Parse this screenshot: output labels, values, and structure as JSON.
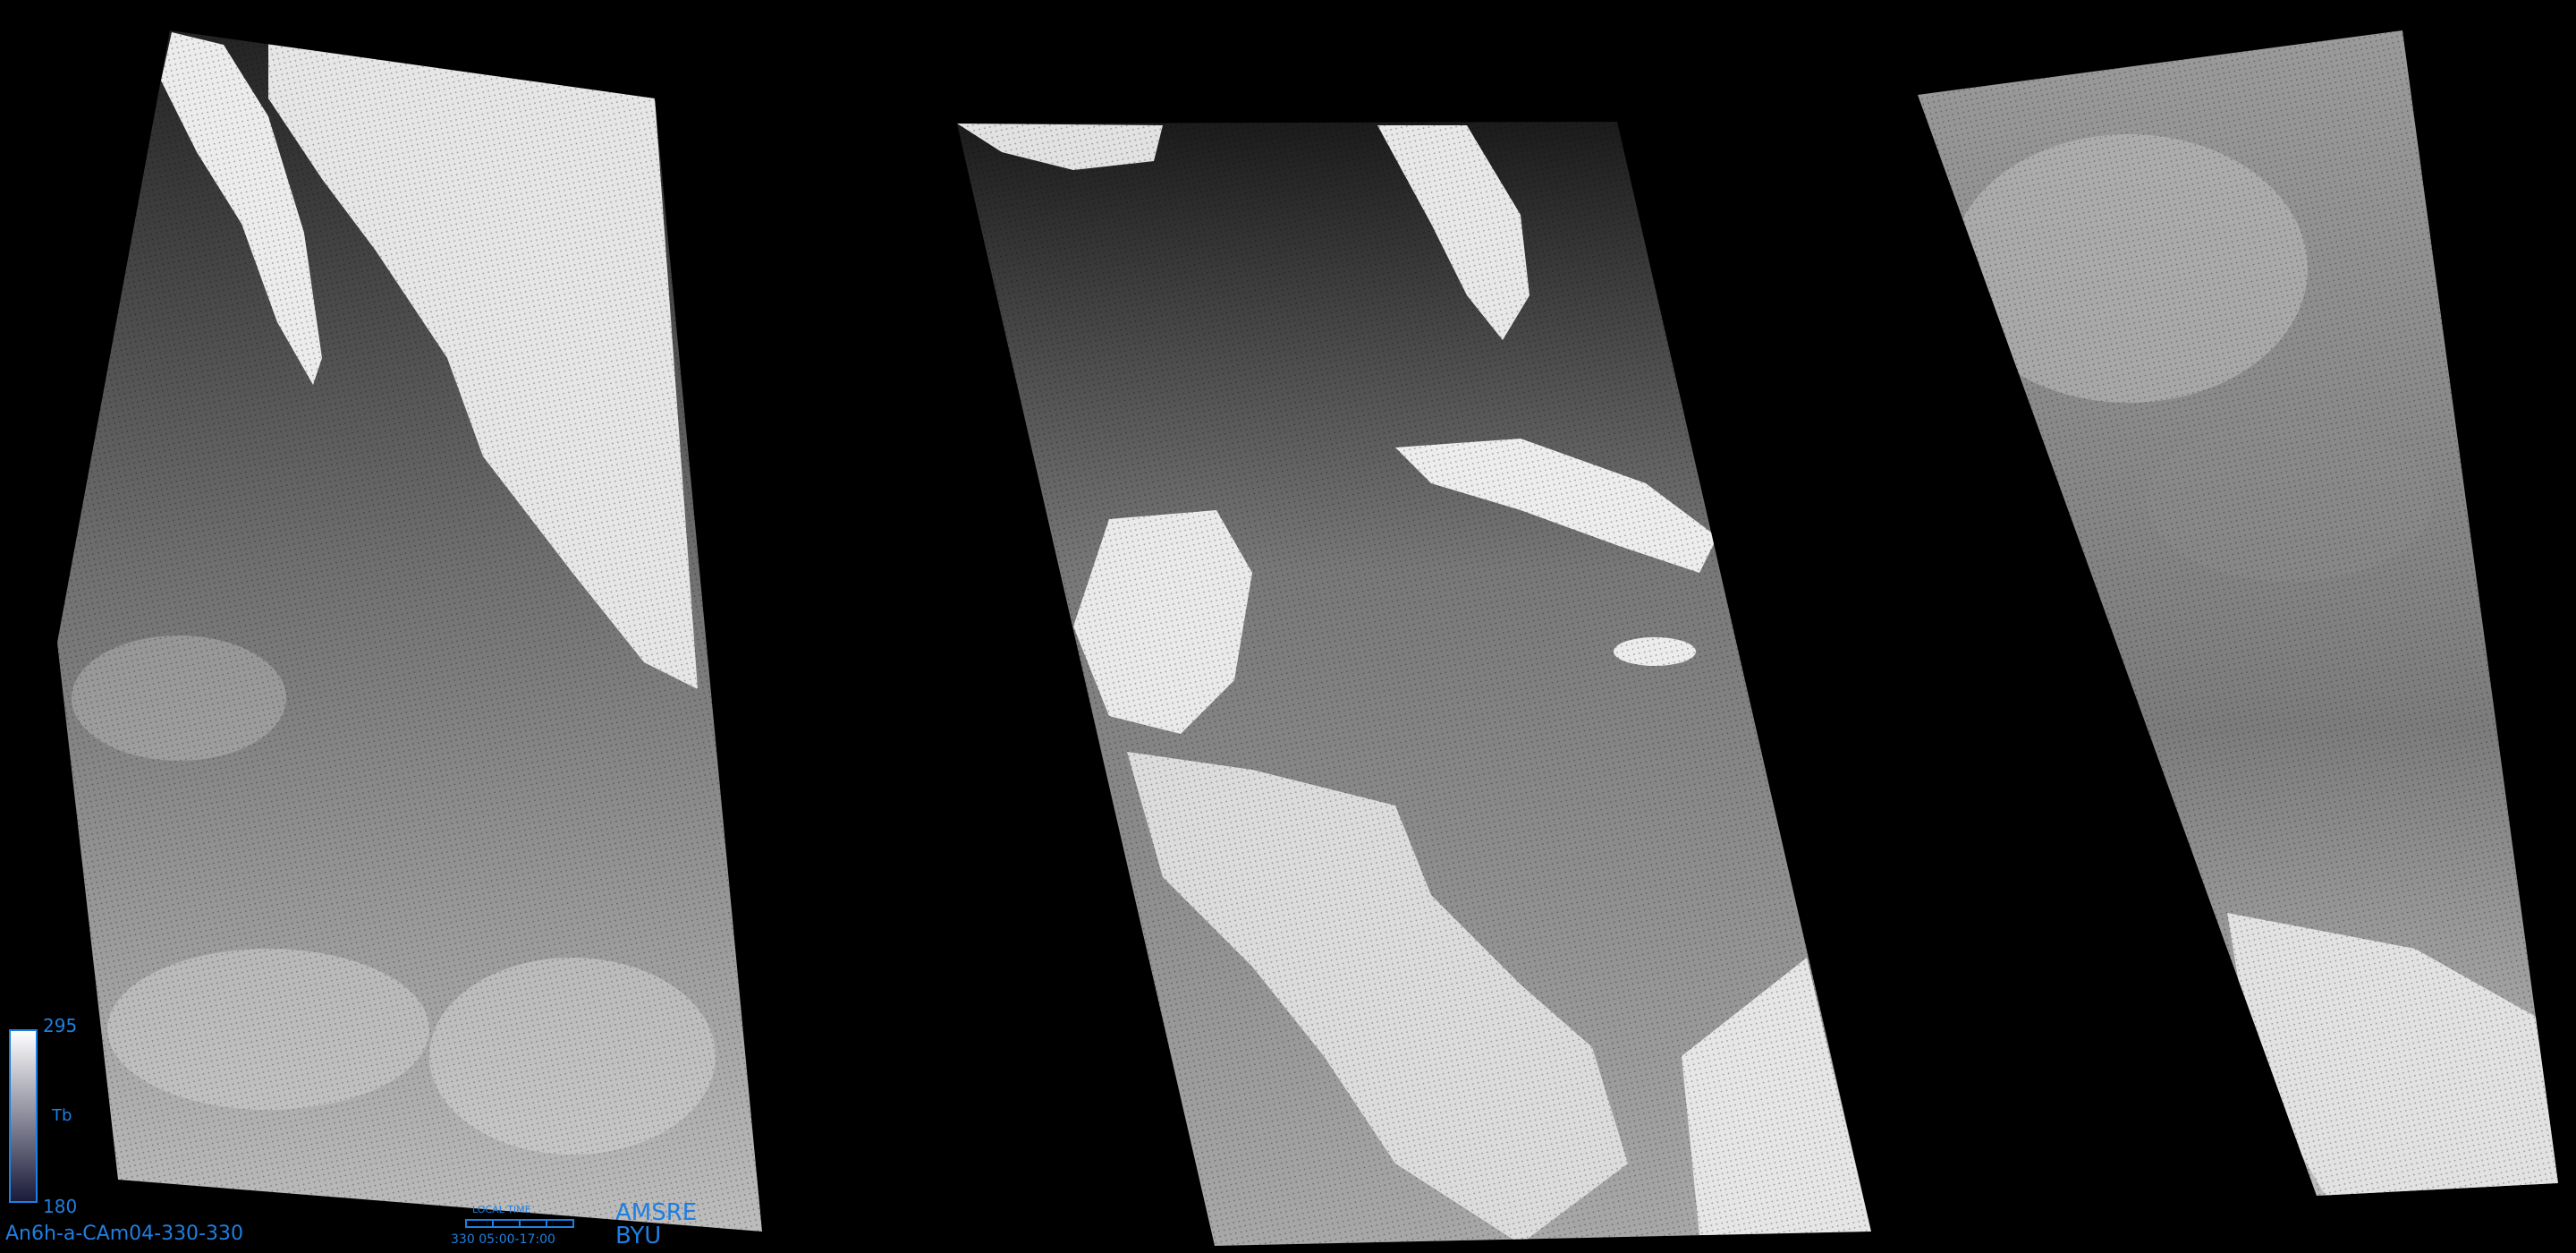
{
  "image": {
    "product_id": "An6h-a-CAm04-330-330",
    "sensor": "AMSRE",
    "organization": "BYU",
    "colorbar": {
      "max_label": "295",
      "min_label": "180",
      "variable_label": "Tb",
      "top_color": "#ffffff",
      "bottom_color": "#1a1a3a"
    },
    "local_time": {
      "title": "LOCAL TIME",
      "day_label": "330",
      "range_label": "05:00-17:00"
    },
    "text_color": "#1f7fe0"
  }
}
